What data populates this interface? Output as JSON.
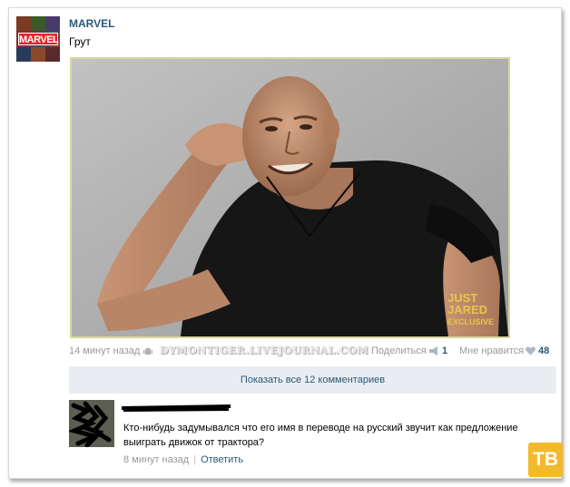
{
  "post": {
    "author": "MARVEL",
    "avatar_logo": "MARVEL",
    "text": "Грут",
    "photo_watermark": [
      "JUST",
      "JARED",
      "EXCLUSIVE"
    ]
  },
  "meta": {
    "time": "14 минут назад",
    "platform_icon": "android-icon",
    "site_watermark": "DYMONTIGER.LIVEJOURNAL.COM",
    "share_label": "Поделиться",
    "share_count": "1",
    "like_label": "Мне нравится",
    "like_count": "48"
  },
  "comments": {
    "show_all_label": "Показать все 12 комментариев"
  },
  "comment": {
    "text": "Кто-нибудь задумывался что его имя в переводе на русский звучит как предложение выиграть движок от трактора?",
    "time": "8 минут назад",
    "reply_label": "Ответить"
  },
  "badge": {
    "label": "ТВ"
  },
  "colors": {
    "link": "#2b587a",
    "muted": "#999999",
    "comments_bar": "#e9edf1",
    "badge": "#f4b92a"
  }
}
